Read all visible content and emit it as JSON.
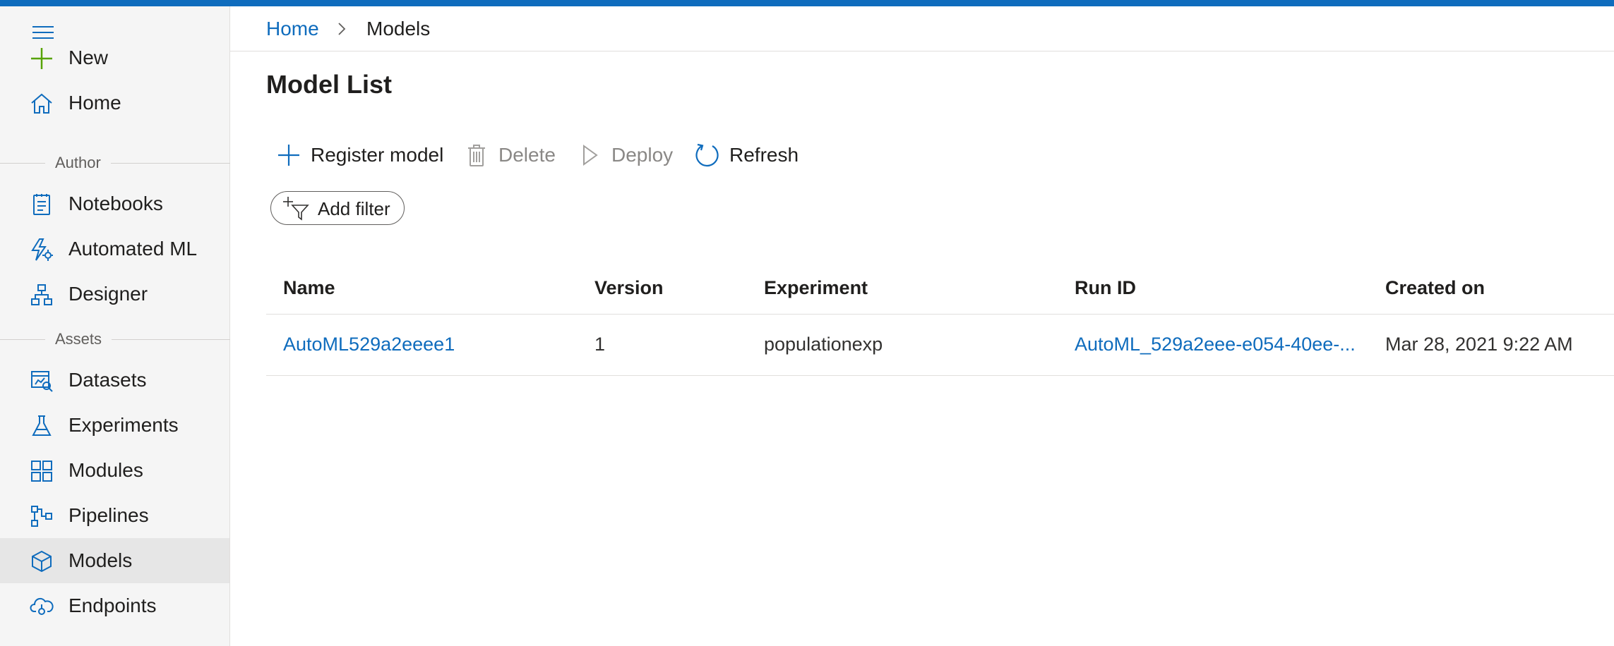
{
  "colors": {
    "accent": "#0f6cbd",
    "new_icon": "#57a300",
    "sidebar_bg": "#f5f5f5",
    "active_item_bg": "#e6e6e6"
  },
  "sidebar": {
    "menu_icon": "hamburger-icon",
    "top_items": [
      {
        "label": "New",
        "icon": "plus-icon"
      },
      {
        "label": "Home",
        "icon": "home-icon"
      }
    ],
    "sections": [
      {
        "title": "Author",
        "items": [
          {
            "label": "Notebooks",
            "icon": "notebook-icon"
          },
          {
            "label": "Automated ML",
            "icon": "automated-ml-icon"
          },
          {
            "label": "Designer",
            "icon": "designer-icon"
          }
        ]
      },
      {
        "title": "Assets",
        "items": [
          {
            "label": "Datasets",
            "icon": "dataset-icon"
          },
          {
            "label": "Experiments",
            "icon": "flask-icon"
          },
          {
            "label": "Modules",
            "icon": "modules-icon"
          },
          {
            "label": "Pipelines",
            "icon": "pipeline-icon"
          },
          {
            "label": "Models",
            "icon": "cube-icon",
            "active": true
          },
          {
            "label": "Endpoints",
            "icon": "cloud-endpoint-icon"
          }
        ]
      }
    ]
  },
  "breadcrumb": {
    "home": "Home",
    "current": "Models"
  },
  "page_title": "Model List",
  "toolbar": {
    "register": "Register model",
    "delete": "Delete",
    "deploy": "Deploy",
    "refresh": "Refresh"
  },
  "filter": {
    "label": "Add filter"
  },
  "table": {
    "columns": [
      "Name",
      "Version",
      "Experiment",
      "Run ID",
      "Created on"
    ],
    "rows": [
      {
        "name": "AutoML529a2eeee1",
        "version": "1",
        "experiment": "populationexp",
        "run_id": "AutoML_529a2eee-e054-40ee-...",
        "created_on": "Mar 28, 2021 9:22 AM"
      }
    ]
  }
}
